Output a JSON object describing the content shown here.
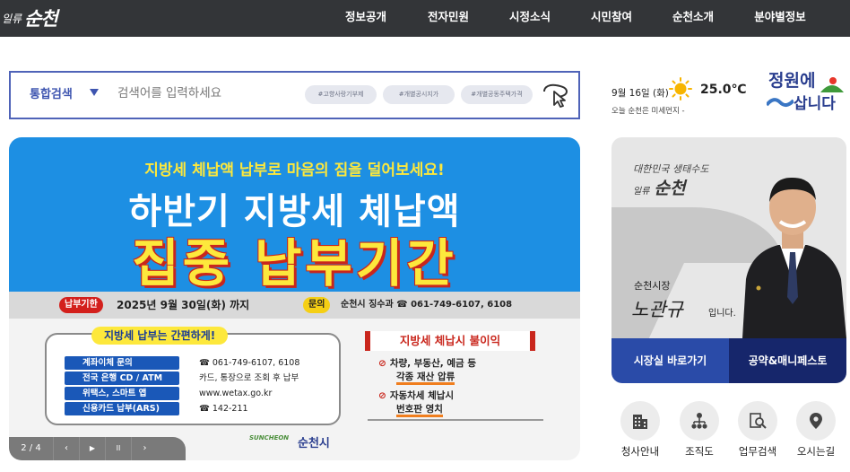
{
  "header": {
    "logo_small": "일류",
    "logo_big": "순천",
    "nav": [
      "정보공개",
      "전자민원",
      "시정소식",
      "시민참여",
      "순천소개",
      "분야별정보"
    ]
  },
  "search": {
    "category": "통합검색",
    "placeholder": "검색어를 입력하세요",
    "chips": [
      "#고향사랑기부제",
      "#개별공시지가",
      "#개별공동주택가격"
    ]
  },
  "weather": {
    "date": "9월 16일 (화)",
    "temperature": "25.0℃",
    "air_quality": "오늘 순천은 미세먼지 -"
  },
  "slogan": {
    "line1": "정원에",
    "line2": "삽니다"
  },
  "banner": {
    "subtitle": "지방세 체납액 납부로 마음의 짐을 덜어보세요!",
    "title_line1": "하반기 지방세 체납액",
    "title_line2": "집중 납부기간",
    "period_label": "납부기한",
    "period_text": "2025년 9월 30일(화) 까지",
    "contact_label": "문의",
    "contact_text": "순천시 징수과 ☎ 061-749-6107, 6108",
    "methods_title": "지방세 납부는 간편하게!",
    "methods": [
      {
        "key": "계좌이체 문의",
        "value": "☎ 061-749-6107, 6108"
      },
      {
        "key": "전국 은행 CD / ATM",
        "value": "카드, 통장으로 조회 후 납부"
      },
      {
        "key": "위택스, 스마트 앱",
        "value": "www.wetax.go.kr"
      },
      {
        "key": "신용카드 납부(ARS)",
        "value": "☎ 142-211"
      }
    ],
    "penalty_title": "지방세 체납시 불이익",
    "penalties": [
      {
        "line1": "차량, 부동산, 예금 등",
        "line2": "각종 재산 압류"
      },
      {
        "line1": "자동차세 체납시",
        "line2": "번호판 영치"
      }
    ],
    "city_mark": "SUNCHEON",
    "city_name": "순천시"
  },
  "slider": {
    "counter": "2 / 4",
    "prev": "‹",
    "play": "▶",
    "pause": "II",
    "next": "›"
  },
  "mayor": {
    "slogan": "대한민국 생태수도",
    "logo_small": "일류",
    "logo_big": "순천",
    "title": "순천시장",
    "signature": "노관규",
    "suffix": "입니다.",
    "btn_office": "시장실 바로가기",
    "btn_pledge": "공약&매니페스토"
  },
  "quick_links": [
    {
      "label": "청사안내",
      "icon": "building-icon"
    },
    {
      "label": "조직도",
      "icon": "org-chart-icon"
    },
    {
      "label": "업무검색",
      "icon": "document-search-icon"
    },
    {
      "label": "오시는길",
      "icon": "location-pin-icon"
    }
  ],
  "colors": {
    "nav_bg": "#333538",
    "search_border": "#4f63b8",
    "banner_blue": "#1d8fe3",
    "banner_yellow": "#fde83c",
    "mayor_btn_a": "#2a4ba8",
    "mayor_btn_b": "#16266b"
  }
}
